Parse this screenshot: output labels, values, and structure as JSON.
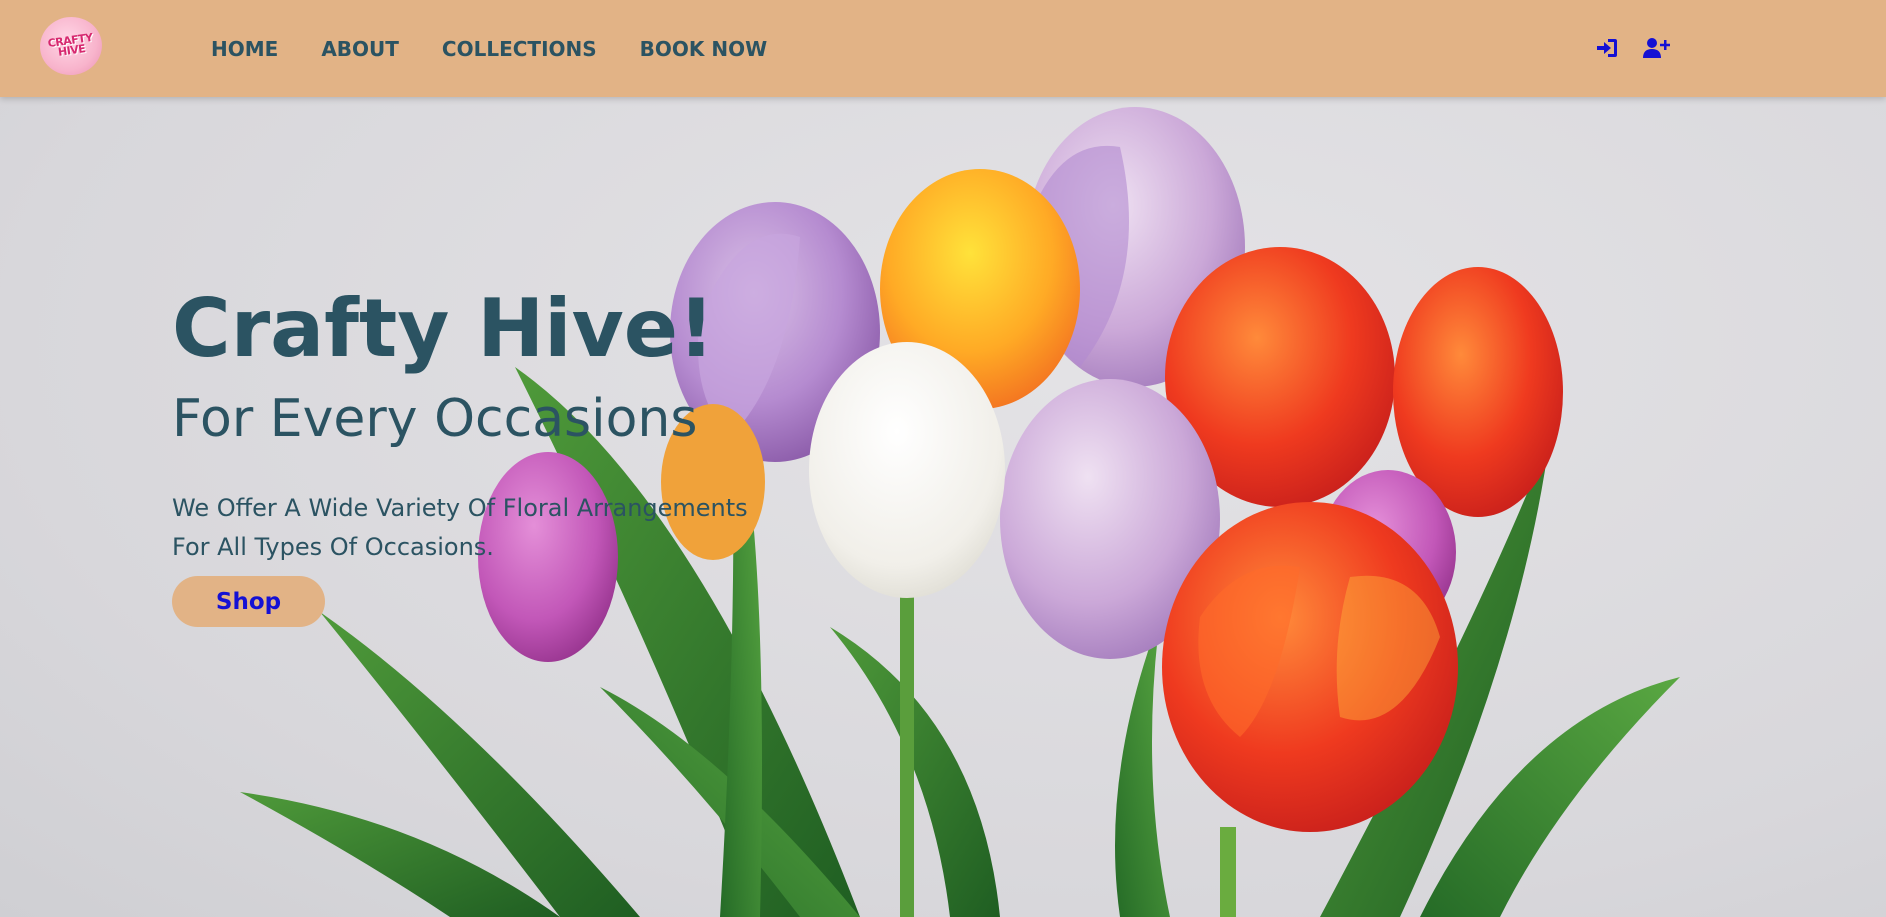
{
  "header": {
    "logo_text": [
      "CRAFTY",
      "HIVE"
    ],
    "nav": [
      {
        "label": "HOME"
      },
      {
        "label": "ABOUT"
      },
      {
        "label": "COLLECTIONS"
      },
      {
        "label": "BOOK NOW"
      }
    ],
    "icons": [
      "sign-in-icon",
      "user-plus-icon"
    ]
  },
  "hero": {
    "title": "Crafty Hive!",
    "subtitle": "For Every Occasions",
    "description": "We Offer A Wide Variety Of Floral Arrangements For All Types Of Occasions.",
    "button_label": "Shop"
  },
  "colors": {
    "header_bg": "#e2b386",
    "heading_text": "#2b5362",
    "button_bg": "#e2b386",
    "button_text": "#1410d4",
    "icon_color": "#1410d4",
    "hero_bg": "#dedde0"
  }
}
